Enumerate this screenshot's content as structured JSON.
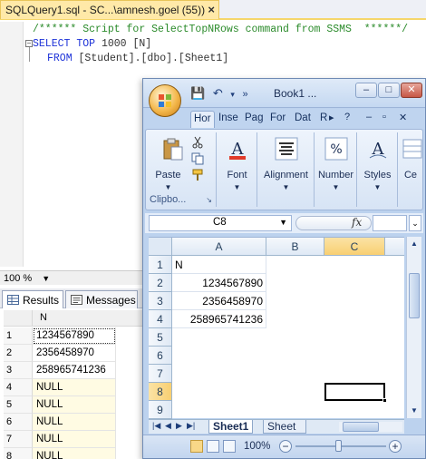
{
  "ssms": {
    "tab_title": "SQLQuery1.sql - SC...\\amnesh.goel (55))",
    "tab_close": "×",
    "code": {
      "line1": "/****** Script for SelectTopNRows command from SSMS  ******/",
      "line2_kw1": "SELECT",
      "line2_kw2": "TOP",
      "line2_rest": " 1000 [N]",
      "line3_kw": "FROM",
      "line3_rest": " [Student].[dbo].[Sheet1]"
    },
    "zoom": "100 %",
    "results_tabs": {
      "results": "Results",
      "messages": "Messages"
    },
    "grid": {
      "column": "N",
      "rows": [
        {
          "num": "1",
          "value": "1234567890"
        },
        {
          "num": "2",
          "value": "2356458970"
        },
        {
          "num": "3",
          "value": "258965741236"
        },
        {
          "num": "4",
          "value": "NULL"
        },
        {
          "num": "5",
          "value": "NULL"
        },
        {
          "num": "6",
          "value": "NULL"
        },
        {
          "num": "7",
          "value": "NULL"
        },
        {
          "num": "8",
          "value": "NULL"
        }
      ]
    }
  },
  "excel": {
    "title": "Book1 ...",
    "window_buttons": {
      "minimize": "–",
      "maximize": "□",
      "close": "✕"
    },
    "tabs": [
      "Hor",
      "Inse",
      "Pag",
      "For",
      "Dat",
      "R"
    ],
    "ribbon": {
      "paste": "Paste",
      "clipboard": "Clipbo...",
      "font": "Font",
      "alignment": "Alignment",
      "number": "Number",
      "styles": "Styles",
      "cells": "Ce"
    },
    "name_box": "C8",
    "fx": "fx",
    "columns": [
      "A",
      "B",
      "C"
    ],
    "rows": [
      "1",
      "2",
      "3",
      "4",
      "5",
      "6",
      "7",
      "8",
      "9"
    ],
    "cells": {
      "A1": "N",
      "A2": "1234567890",
      "A3": "2356458970",
      "A4": "258965741236"
    },
    "sheet_tabs": [
      "Sheet1",
      "Sheet"
    ],
    "zoom": "100%",
    "accent": "#f8cf72"
  }
}
